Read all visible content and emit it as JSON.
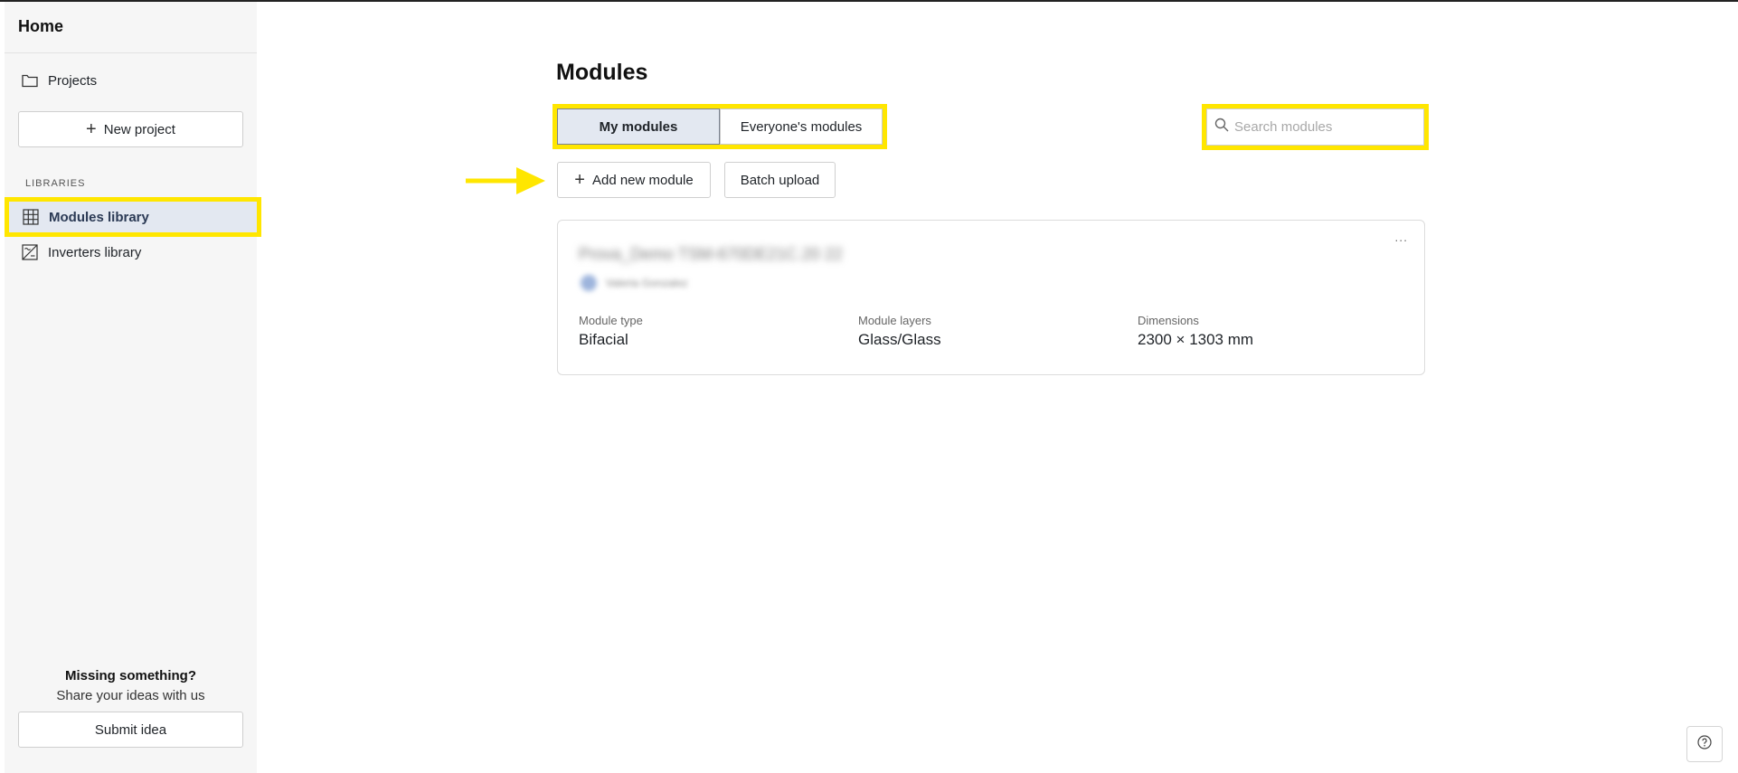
{
  "sidebar": {
    "title": "Home",
    "projects_label": "Projects",
    "new_project_label": "New project",
    "section_label": "LIBRARIES",
    "items": [
      {
        "label": "Modules library",
        "icon": "grid-icon",
        "active": true
      },
      {
        "label": "Inverters library",
        "icon": "inverter-icon",
        "active": false
      }
    ],
    "missing_title": "Missing something?",
    "missing_sub": "Share your ideas with us",
    "submit_label": "Submit idea"
  },
  "main": {
    "title": "Modules",
    "tabs": [
      {
        "label": "My modules",
        "active": true
      },
      {
        "label": "Everyone's modules",
        "active": false
      }
    ],
    "search": {
      "placeholder": "Search modules",
      "value": ""
    },
    "add_label": "Add new module",
    "batch_label": "Batch upload",
    "modules": [
      {
        "name": "Prova_Demo TSM-670DE21C.20 22",
        "owner": "Valeria Gonzalez",
        "menu": "...",
        "fields": [
          {
            "label": "Module type",
            "value": "Bifacial"
          },
          {
            "label": "Module layers",
            "value": "Glass/Glass"
          },
          {
            "label": "Dimensions",
            "value": "2300 × 1303 mm"
          }
        ]
      }
    ]
  },
  "help_icon": "help-icon",
  "colors": {
    "highlight": "#ffe600",
    "active_bg": "#e3e8f1",
    "sidebar_bg": "#f6f6f6"
  }
}
